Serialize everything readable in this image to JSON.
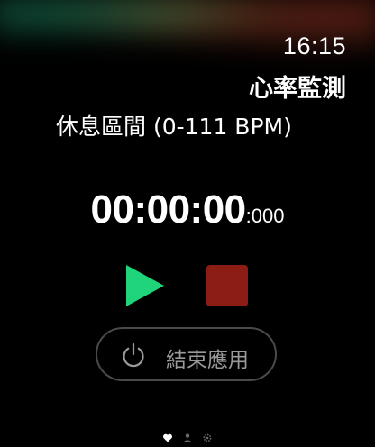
{
  "status_bar": {
    "time": "16:15"
  },
  "app": {
    "title": "心率監測"
  },
  "zone": {
    "label": "休息區間 (0-111 BPM)"
  },
  "timer": {
    "main": "00:00:00",
    "milliseconds": ":000"
  },
  "controls": {
    "play_color": "#1fd47a",
    "stop_color": "#8b1d15"
  },
  "end_app": {
    "label": "結束應用"
  },
  "page_indicator": {
    "pages": [
      "heart-icon",
      "person-icon",
      "gear-icon"
    ],
    "active_index": 0
  },
  "icons": {
    "play": "play-icon",
    "stop": "stop-icon",
    "power": "power-icon"
  }
}
